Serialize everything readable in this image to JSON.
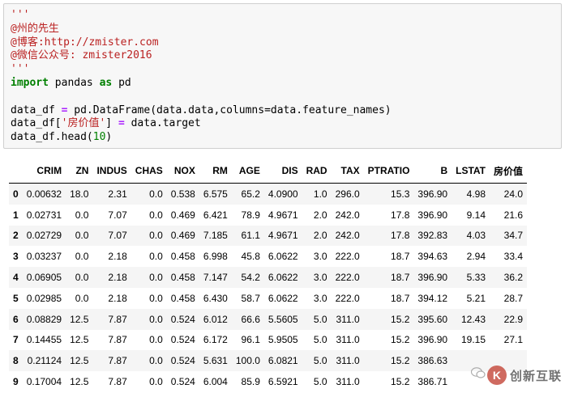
{
  "code_cell": {
    "lines": [
      "'''",
      "@州的先生",
      "@博客:http://zmister.com",
      "@微信公众号: zmister2016",
      "'''",
      "",
      "data_df = pd.DataFrame(data.data,columns=data.feature_names)",
      "data_df['房价值'] = data.target",
      "data_df.head(10)"
    ],
    "import_keyword": "import",
    "import_module": " pandas ",
    "as_keyword": "as",
    "import_alias": " pd",
    "line7_prefix": "data_df[",
    "line7_string": "'房价值'",
    "line7_middle": "] ",
    "line7_eq": "=",
    "line7_suffix": " data.target",
    "line6_prefix": "data_df ",
    "line6_eq": "=",
    "line6_suffix": " pd.DataFrame(data.data,columns=data.feature_names)",
    "line8_prefix": "data_df.head(",
    "line8_num": "10",
    "line8_suffix": ")"
  },
  "table": {
    "columns": [
      "",
      "CRIM",
      "ZN",
      "INDUS",
      "CHAS",
      "NOX",
      "RM",
      "AGE",
      "DIS",
      "RAD",
      "TAX",
      "PTRATIO",
      "B",
      "LSTAT",
      "房价值"
    ],
    "rows": [
      [
        "0",
        "0.00632",
        "18.0",
        "2.31",
        "0.0",
        "0.538",
        "6.575",
        "65.2",
        "4.0900",
        "1.0",
        "296.0",
        "15.3",
        "396.90",
        "4.98",
        "24.0"
      ],
      [
        "1",
        "0.02731",
        "0.0",
        "7.07",
        "0.0",
        "0.469",
        "6.421",
        "78.9",
        "4.9671",
        "2.0",
        "242.0",
        "17.8",
        "396.90",
        "9.14",
        "21.6"
      ],
      [
        "2",
        "0.02729",
        "0.0",
        "7.07",
        "0.0",
        "0.469",
        "7.185",
        "61.1",
        "4.9671",
        "2.0",
        "242.0",
        "17.8",
        "392.83",
        "4.03",
        "34.7"
      ],
      [
        "3",
        "0.03237",
        "0.0",
        "2.18",
        "0.0",
        "0.458",
        "6.998",
        "45.8",
        "6.0622",
        "3.0",
        "222.0",
        "18.7",
        "394.63",
        "2.94",
        "33.4"
      ],
      [
        "4",
        "0.06905",
        "0.0",
        "2.18",
        "0.0",
        "0.458",
        "7.147",
        "54.2",
        "6.0622",
        "3.0",
        "222.0",
        "18.7",
        "396.90",
        "5.33",
        "36.2"
      ],
      [
        "5",
        "0.02985",
        "0.0",
        "2.18",
        "0.0",
        "0.458",
        "6.430",
        "58.7",
        "6.0622",
        "3.0",
        "222.0",
        "18.7",
        "394.12",
        "5.21",
        "28.7"
      ],
      [
        "6",
        "0.08829",
        "12.5",
        "7.87",
        "0.0",
        "0.524",
        "6.012",
        "66.6",
        "5.5605",
        "5.0",
        "311.0",
        "15.2",
        "395.60",
        "12.43",
        "22.9"
      ],
      [
        "7",
        "0.14455",
        "12.5",
        "7.87",
        "0.0",
        "0.524",
        "6.172",
        "96.1",
        "5.9505",
        "5.0",
        "311.0",
        "15.2",
        "396.90",
        "19.15",
        "27.1"
      ],
      [
        "8",
        "0.21124",
        "12.5",
        "7.87",
        "0.0",
        "0.524",
        "5.631",
        "100.0",
        "6.0821",
        "5.0",
        "311.0",
        "15.2",
        "386.63",
        "",
        ""
      ],
      [
        "9",
        "0.17004",
        "12.5",
        "7.87",
        "0.0",
        "0.524",
        "6.004",
        "85.9",
        "6.5921",
        "5.0",
        "311.0",
        "15.2",
        "386.71",
        "",
        ""
      ]
    ]
  },
  "watermark": {
    "logo_glyph": "K",
    "text": "创新互联"
  },
  "colors": {
    "string": "#ba2121",
    "keyword": "#008000",
    "operator": "#aa22ff",
    "cell_bg": "#f7f7f7"
  }
}
